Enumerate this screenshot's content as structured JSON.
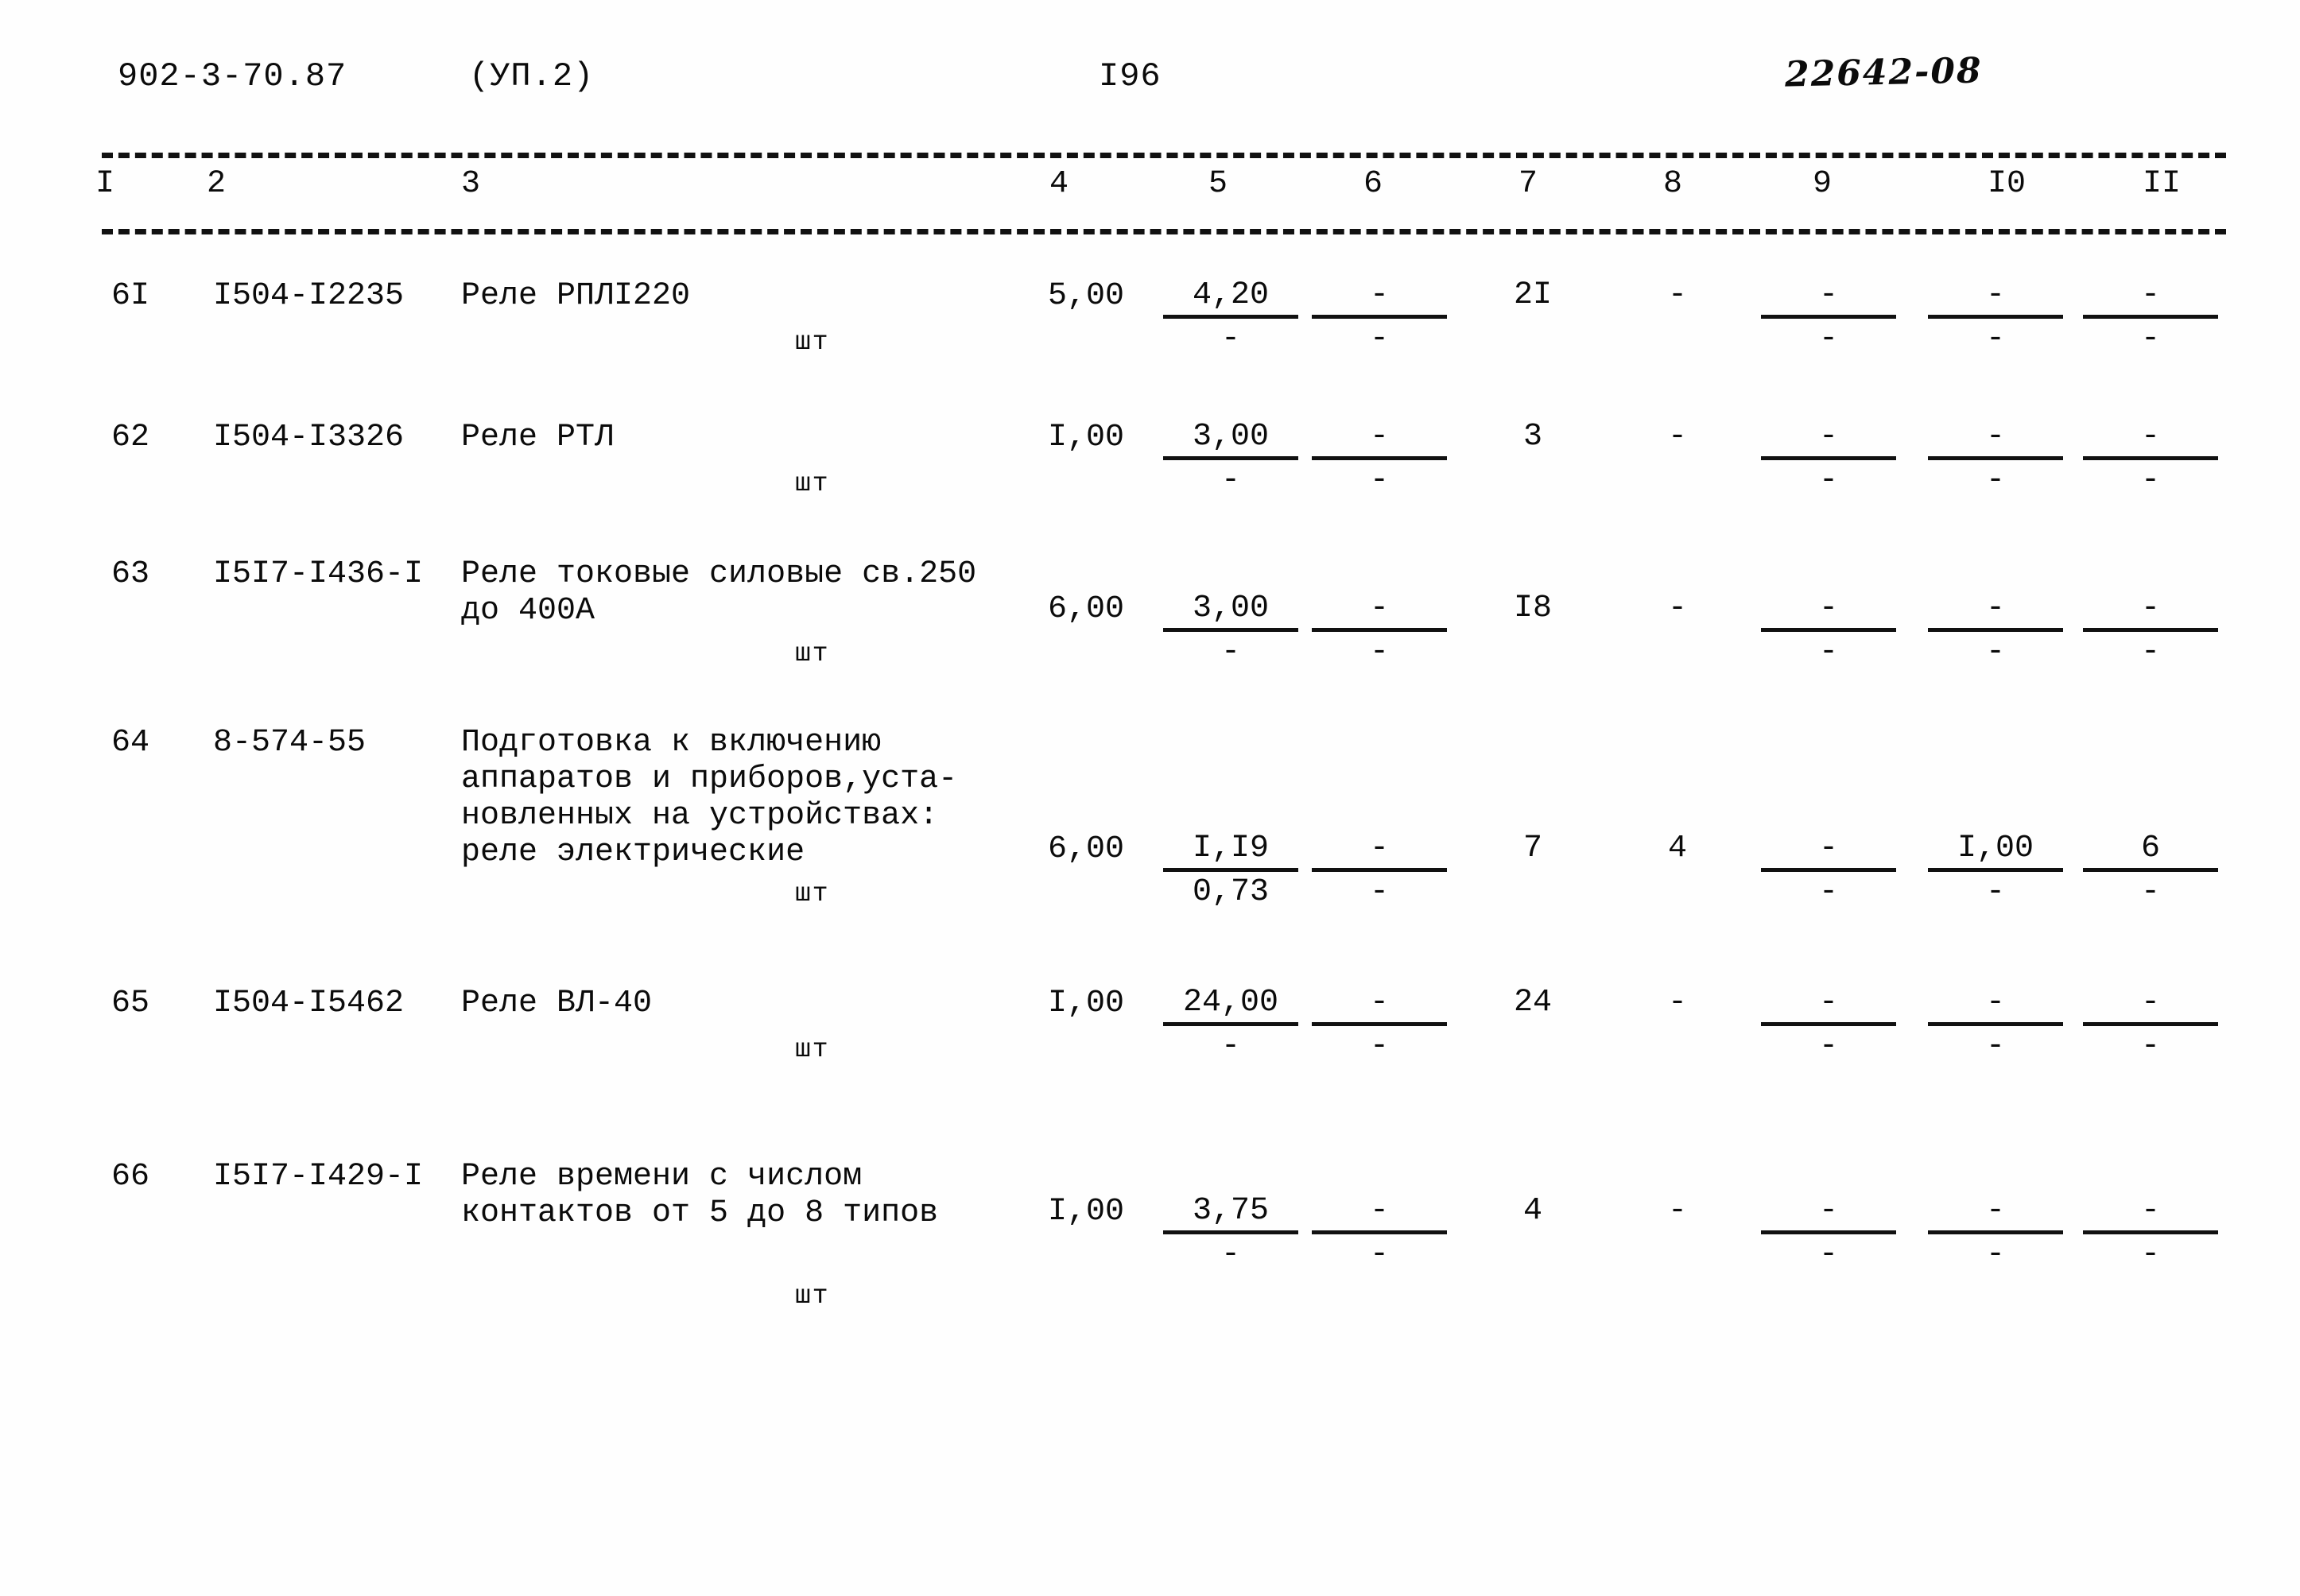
{
  "header": {
    "doc_code": "902-3-70.87",
    "variant": "(УП.2)",
    "page_number": "I96",
    "archive_number": "22642-08"
  },
  "table": {
    "column_headers": [
      "I",
      "2",
      "3",
      "4",
      "5",
      "6",
      "7",
      "8",
      "9",
      "I0",
      "II"
    ],
    "rows": [
      {
        "num": "6I",
        "code": "I504-I2235",
        "desc_lines": [
          "Реле РПЛI220"
        ],
        "unit": "шт",
        "qty": "5,00",
        "c5": {
          "num": "4,20",
          "den": "-"
        },
        "c6": {
          "num": "-",
          "den": "-"
        },
        "c7": "2I",
        "c8": "-",
        "c9": {
          "num": "-",
          "den": "-"
        },
        "c10": {
          "num": "-",
          "den": "-"
        },
        "c11": {
          "num": "-",
          "den": "-"
        }
      },
      {
        "num": "62",
        "code": "I504-I3326",
        "desc_lines": [
          "Реле РТЛ"
        ],
        "unit": "шт",
        "qty": "I,00",
        "c5": {
          "num": "3,00",
          "den": "-"
        },
        "c6": {
          "num": "-",
          "den": "-"
        },
        "c7": "3",
        "c8": "-",
        "c9": {
          "num": "-",
          "den": "-"
        },
        "c10": {
          "num": "-",
          "den": "-"
        },
        "c11": {
          "num": "-",
          "den": "-"
        }
      },
      {
        "num": "63",
        "code": "I5I7-I436-I",
        "desc_lines": [
          "Реле токовые силовые св.250",
          "до 400А"
        ],
        "unit": "шт",
        "qty": "6,00",
        "c5": {
          "num": "3,00",
          "den": "-"
        },
        "c6": {
          "num": "-",
          "den": "-"
        },
        "c7": "I8",
        "c8": "-",
        "c9": {
          "num": "-",
          "den": "-"
        },
        "c10": {
          "num": "-",
          "den": "-"
        },
        "c11": {
          "num": "-",
          "den": "-"
        }
      },
      {
        "num": "64",
        "code": "8-574-55",
        "desc_lines": [
          "Подготовка к включению",
          "аппаратов и приборов,уста-",
          "новленных на устройствах:",
          "реле электрические"
        ],
        "unit": "шт",
        "qty": "6,00",
        "c5": {
          "num": "I,I9",
          "den": "0,73"
        },
        "c6": {
          "num": "-",
          "den": "-"
        },
        "c7": "7",
        "c8": "4",
        "c9": {
          "num": "-",
          "den": "-"
        },
        "c10": {
          "num": "I,00",
          "den": "-"
        },
        "c11": {
          "num": "6",
          "den": "-"
        }
      },
      {
        "num": "65",
        "code": "I504-I5462",
        "desc_lines": [
          "Реле ВЛ-40"
        ],
        "unit": "шт",
        "qty": "I,00",
        "c5": {
          "num": "24,00",
          "den": "-"
        },
        "c6": {
          "num": "-",
          "den": "-"
        },
        "c7": "24",
        "c8": "-",
        "c9": {
          "num": "-",
          "den": "-"
        },
        "c10": {
          "num": "-",
          "den": "-"
        },
        "c11": {
          "num": "-",
          "den": "-"
        }
      },
      {
        "num": "66",
        "code": "I5I7-I429-I",
        "desc_lines": [
          "Реле времени с числом",
          "контактов от 5 до 8 типов"
        ],
        "unit": "шт",
        "qty": "I,00",
        "c5": {
          "num": "3,75",
          "den": "-"
        },
        "c6": {
          "num": "-",
          "den": "-"
        },
        "c7": "4",
        "c8": "-",
        "c9": {
          "num": "-",
          "den": "-"
        },
        "c10": {
          "num": "-",
          "den": "-"
        },
        "c11": {
          "num": "-",
          "den": "-"
        }
      }
    ]
  }
}
